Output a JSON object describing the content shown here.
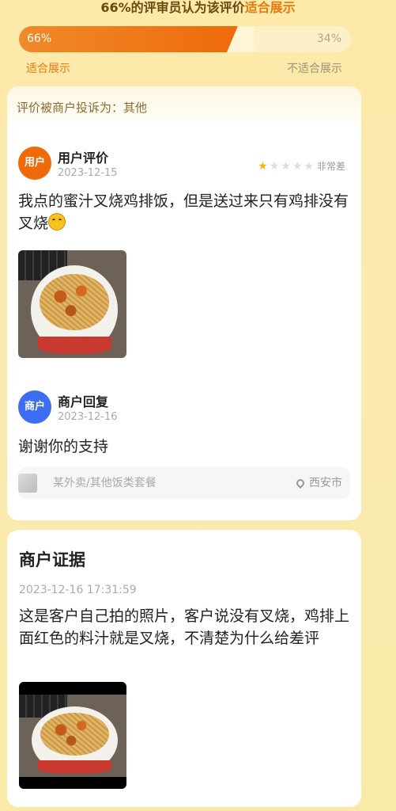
{
  "vote": {
    "summary_pct": "66%",
    "summary_mid": "的评审员认为该评价",
    "summary_accent": "适合展示",
    "suitable_fraction": 0.66,
    "pct_suitable": "66%",
    "pct_unsuitable": "34%",
    "label_suitable": "适合展示",
    "label_unsuitable": "不适合展示"
  },
  "review_card": {
    "complaint": "评价被商户投诉为：其他",
    "user": {
      "avatar": "用户",
      "label": "用户评价",
      "date": "2023-12-15",
      "rating": 1,
      "rating_max": 5,
      "rating_text": "非常差",
      "text": "我点的蜜汁叉烧鸡排饭，但是送过来只有鸡排没有叉烧",
      "emoji": "upside-down-face"
    },
    "merchant": {
      "avatar": "商户",
      "label": "商户回复",
      "date": "2023-12-16",
      "text": "谢谢你的支持"
    },
    "shop": {
      "name": "某外卖/其他饭类套餐",
      "location": "西安市"
    }
  },
  "evidence_card": {
    "title": "商户证据",
    "datetime": "2023-12-16 17:31:59",
    "text": "这是客户自己拍的照片，客户说没有叉烧，鸡排上面红色的料汁就是叉烧，不清楚为什么给差评"
  },
  "colors": {
    "accent": "#ee6a0b",
    "merchant": "#3d6df0",
    "star": "#f5b70f"
  }
}
